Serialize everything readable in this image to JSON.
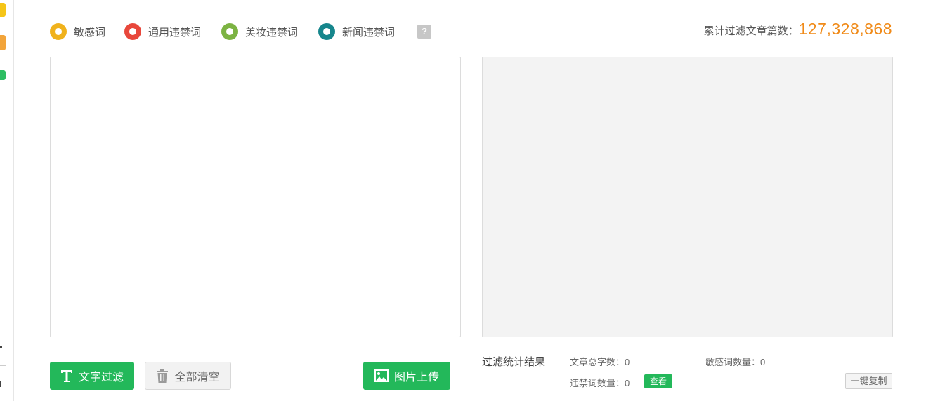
{
  "legend": [
    {
      "label": "敏感词",
      "color": "#f0b21c"
    },
    {
      "label": "通用违禁词",
      "color": "#e8473b"
    },
    {
      "label": "美妆违禁词",
      "color": "#7cb342"
    },
    {
      "label": "新闻违禁词",
      "color": "#16868c"
    }
  ],
  "help": "?",
  "counter": {
    "label": "累计过滤文章篇数：",
    "value": "127,328,868"
  },
  "buttons": {
    "text_filter": "文字过滤",
    "clear_all": "全部清空",
    "image_upload": "图片上传"
  },
  "stats": {
    "title": "过滤统计结果",
    "total_chars": "文章总字数：0",
    "sensitive_count": "敏感词数量：0",
    "banned_count": "违禁词数量：0",
    "view": "查看",
    "copy": "一键复制"
  },
  "colors": {
    "accent_green": "#23b85a",
    "counter_orange": "#f08a18"
  }
}
